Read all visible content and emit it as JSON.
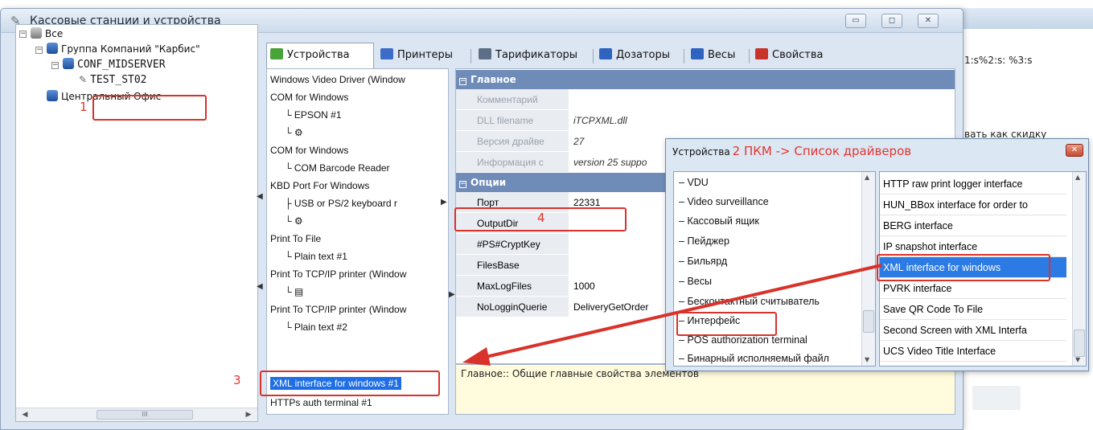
{
  "background_window": {
    "lines": [
      "1:s%2:s: %3:s",
      "вать как скидку"
    ]
  },
  "window": {
    "title": "Кассовые станции и устройства",
    "buttons": {
      "minimize": "▭",
      "maximize": "◻",
      "close": "✕"
    }
  },
  "tree": {
    "root": "Все",
    "group": "Группа Компаний \"Карбис\"",
    "server": "CONF_MIDSERVER",
    "station": "TEST_ST02",
    "office": "Центральный Офис",
    "scroll_thumb_label": "III"
  },
  "tabs": [
    {
      "label": "Устройства",
      "icon": "devices-icon",
      "color": "#4aa33a"
    },
    {
      "label": "Принтеры",
      "icon": "printer-icon",
      "color": "#3d6cc9"
    },
    {
      "label": "Тарификаторы",
      "icon": "tariff-icon",
      "color": "#5d6f86"
    },
    {
      "label": "Дозаторы",
      "icon": "dispenser-icon",
      "color": "#2e64c0"
    },
    {
      "label": "Весы",
      "icon": "scales-icon",
      "color": "#2e64c0"
    },
    {
      "label": "Свойства",
      "icon": "properties-icon",
      "color": "#c8342a"
    }
  ],
  "devices": [
    {
      "text": "Windows Video Driver (Window",
      "sub": false
    },
    {
      "text": "COM for Windows",
      "sub": false
    },
    {
      "text": "└ EPSON #1",
      "sub": true
    },
    {
      "text": "└ ⚙",
      "sub": true
    },
    {
      "text": "COM for Windows",
      "sub": false
    },
    {
      "text": "└ COM Barcode Reader",
      "sub": true
    },
    {
      "text": "KBD Port For Windows",
      "sub": false
    },
    {
      "text": "├ USB or PS/2 keyboard r",
      "sub": true
    },
    {
      "text": "└ ⚙",
      "sub": true
    },
    {
      "text": "Print To File",
      "sub": false
    },
    {
      "text": "└ Plain text #1",
      "sub": true
    },
    {
      "text": "Print To TCP/IP printer (Window",
      "sub": false
    },
    {
      "text": "└ ▤",
      "sub": true
    },
    {
      "text": "Print To TCP/IP printer (Window",
      "sub": false
    },
    {
      "text": "└ Plain text #2",
      "sub": true
    }
  ],
  "selected_device": "XML interface for windows #1",
  "device_after": "HTTPs auth terminal #1",
  "props": {
    "cat_main": "Главное",
    "cat_options": "Опции",
    "main_rows": [
      {
        "name": "Комментарий",
        "value": ""
      },
      {
        "name": "DLL filename",
        "value": "iTCPXML.dll"
      },
      {
        "name": "Версия драйве",
        "value": "27"
      },
      {
        "name": "Информация с",
        "value": "version 25 suppo"
      }
    ],
    "option_rows": [
      {
        "name": "Порт",
        "value": "22331"
      },
      {
        "name": "OutputDir",
        "value": ""
      },
      {
        "name": "#PS#CryptKey",
        "value": ""
      },
      {
        "name": "FilesBase",
        "value": ""
      },
      {
        "name": "MaxLogFiles",
        "value": "1000"
      },
      {
        "name": "NoLogginQuerie",
        "value": "DeliveryGetOrder"
      }
    ]
  },
  "description": "Главное:: Общие главные свойства элементов",
  "popup": {
    "title": "Устройства",
    "annotation": "2 ПКМ -> Список драйверов",
    "close": "✕",
    "types": [
      "VDU",
      "Video surveillance",
      "Кассовый ящик",
      "Пейджер",
      "Бильярд",
      "Весы",
      "Бесконтактный считыватель",
      "Интерфейс",
      "POS authorization terminal",
      "Бинарный исполняемый файл"
    ],
    "drivers": [
      "HTTP raw print logger interface",
      "HUN_BBox interface for order to",
      "BERG interface",
      "IP snapshot interface",
      "XML interface for windows",
      "PVRK interface",
      "Save QR Code To File",
      "Second Screen with XML Interfa",
      "UCS Video Title Interface"
    ]
  },
  "annotations": {
    "one": "1",
    "three": "3",
    "four": "4",
    "color": "#d8322b"
  }
}
